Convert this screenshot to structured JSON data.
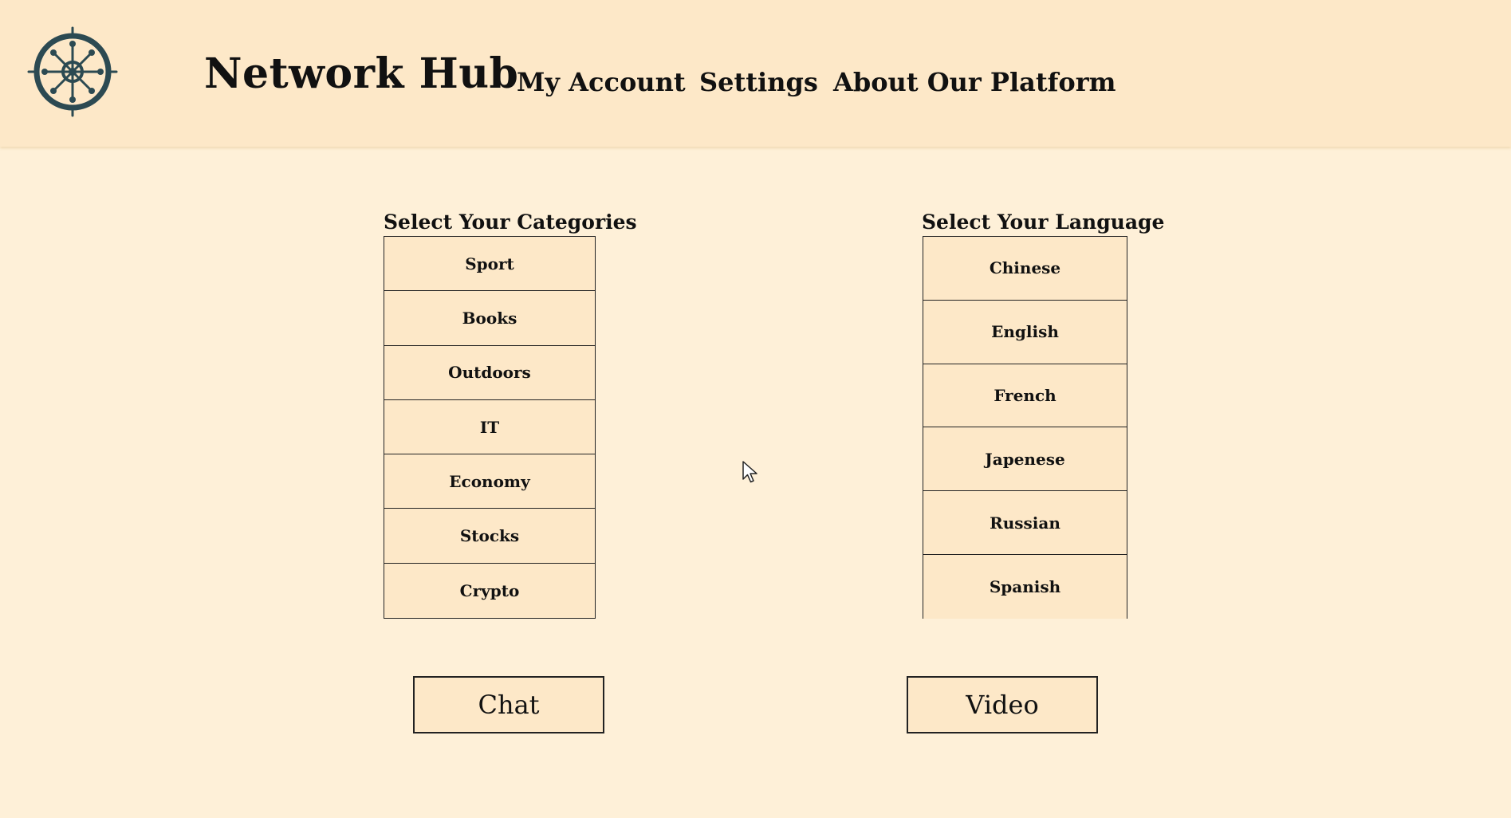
{
  "header": {
    "brand": "Network Hub",
    "logo_icon": "compass-wheel-icon",
    "nav": [
      {
        "label": "My Account"
      },
      {
        "label": "Settings"
      },
      {
        "label": "About Our Platform"
      }
    ]
  },
  "categories": {
    "title": "Select Your Categories",
    "items": [
      "Sport",
      "Books",
      "Outdoors",
      "IT",
      "Economy",
      "Stocks",
      "Crypto"
    ]
  },
  "languages": {
    "title": "Select Your Language",
    "items": [
      "Chinese",
      "English",
      "French",
      "Japenese",
      "Russian",
      "Spanish"
    ]
  },
  "actions": {
    "chat_label": "Chat",
    "video_label": "Video"
  },
  "colors": {
    "header_bg": "#fde8c8",
    "page_bg": "#fef0d8",
    "logo": "#2c4a52",
    "border": "#222222"
  }
}
